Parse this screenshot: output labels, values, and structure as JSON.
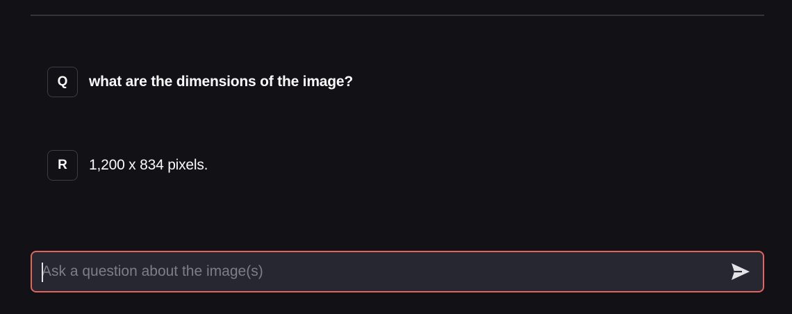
{
  "conversation": {
    "messages": [
      {
        "avatar": "Q",
        "text": "what are the dimensions of the image?"
      },
      {
        "avatar": "R",
        "text": "1,200 x 834 pixels."
      }
    ]
  },
  "chat_input": {
    "placeholder": "Ask a question about the image(s)",
    "value": "",
    "send_icon": "send-arrow-icon"
  },
  "colors": {
    "background": "#111116",
    "input_background": "#262730",
    "input_focus_border": "#e3655d",
    "text": "#fafafa",
    "placeholder": "#7d7e86"
  }
}
